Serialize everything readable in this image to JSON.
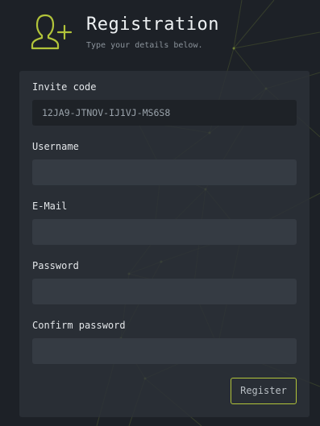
{
  "header": {
    "title": "Registration",
    "subtitle": "Type your details below.",
    "icon": "add-user-icon"
  },
  "form": {
    "invite_code": {
      "label": "Invite code",
      "value": "12JA9-JTNOV-IJ1VJ-MS6S8"
    },
    "username": {
      "label": "Username",
      "value": ""
    },
    "email": {
      "label": "E-Mail",
      "value": ""
    },
    "password": {
      "label": "Password",
      "value": ""
    },
    "confirm_password": {
      "label": "Confirm password",
      "value": ""
    },
    "register_label": "Register"
  },
  "colors": {
    "accent": "#b2c43a",
    "background": "#1d2127",
    "panel": "#2c3138",
    "field": "#353b43"
  }
}
